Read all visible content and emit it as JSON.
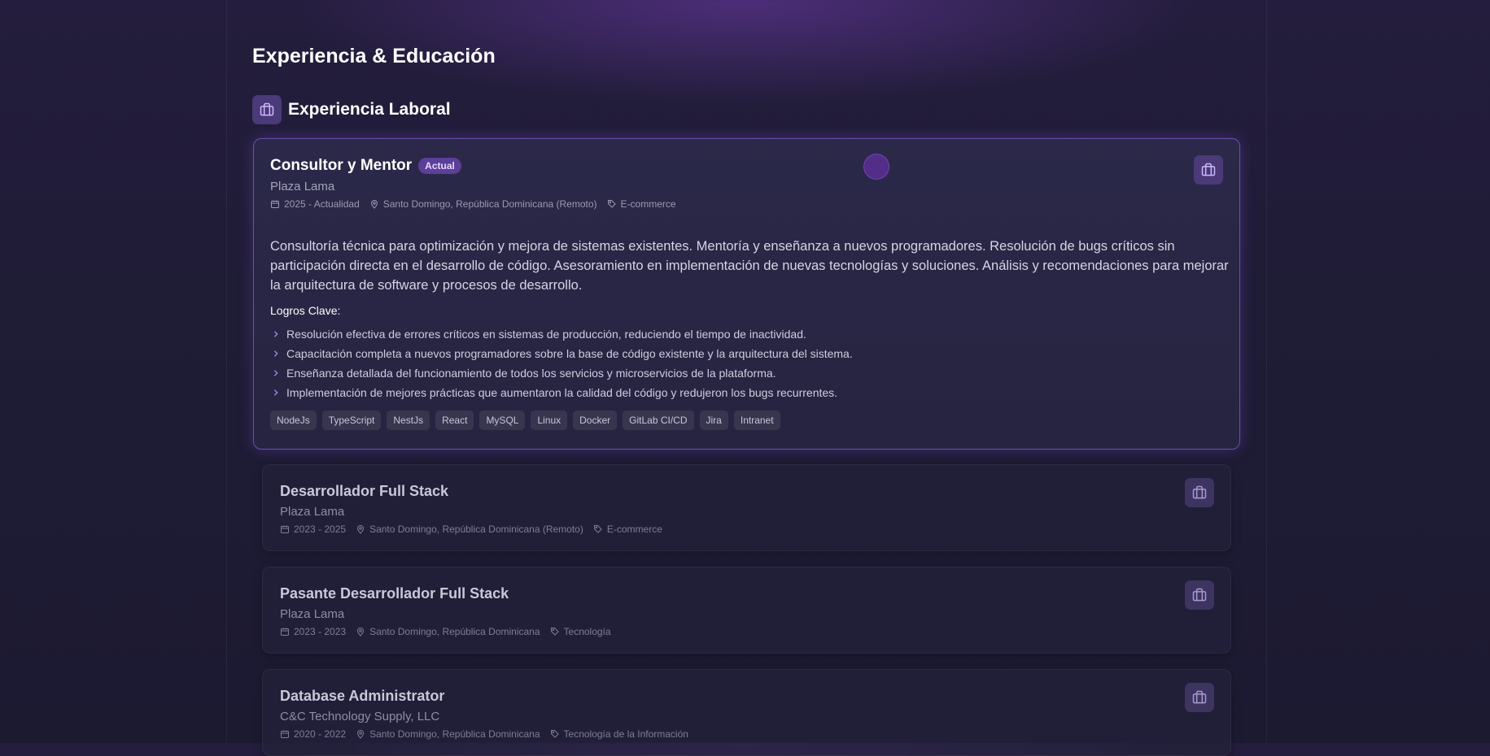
{
  "page": {
    "title": "Experiencia & Educación"
  },
  "section": {
    "title": "Experiencia Laboral",
    "icon": "briefcase-icon"
  },
  "jobs": [
    {
      "title": "Consultor y Mentor",
      "badge": "Actual",
      "company": "Plaza Lama",
      "period": "2025 - Actualidad",
      "location": "Santo Domingo, República Dominicana (Remoto)",
      "category": "E-commerce",
      "description": "Consultoría técnica para optimización y mejora de sistemas existentes. Mentoría y enseñanza a nuevos programadores. Resolución de bugs críticos sin participación directa en el desarrollo de código. Asesoramiento en implementación de nuevas tecnologías y soluciones. Análisis y recomendaciones para mejorar la arquitectura de software y procesos de desarrollo.",
      "achievements_title": "Logros Clave:",
      "achievements": [
        "Resolución efectiva de errores críticos en sistemas de producción, reduciendo el tiempo de inactividad.",
        "Capacitación completa a nuevos programadores sobre la base de código existente y la arquitectura del sistema.",
        "Enseñanza detallada del funcionamiento de todos los servicios y microservicios de la plataforma.",
        "Implementación de mejores prácticas que aumentaron la calidad del código y redujeron los bugs recurrentes."
      ],
      "tags": [
        "NodeJs",
        "TypeScript",
        "NestJs",
        "React",
        "MySQL",
        "Linux",
        "Docker",
        "GitLab CI/CD",
        "Jira",
        "Intranet"
      ]
    },
    {
      "title": "Desarrollador Full Stack",
      "company": "Plaza Lama",
      "period": "2023 - 2025",
      "location": "Santo Domingo, República Dominicana (Remoto)",
      "category": "E-commerce"
    },
    {
      "title": "Pasante Desarrollador Full Stack",
      "company": "Plaza Lama",
      "period": "2023 - 2023",
      "location": "Santo Domingo, República Dominicana",
      "category": "Tecnología"
    },
    {
      "title": "Database Administrator",
      "company": "C&C Technology Supply, LLC",
      "period": "2020 - 2022",
      "location": "Santo Domingo, República Dominicana",
      "category": "Tecnología de la Información"
    }
  ],
  "colors": {
    "accent": "#6b4fb0",
    "badge_bg": "#5b3f98",
    "icon_bg": "#4a3a78"
  }
}
